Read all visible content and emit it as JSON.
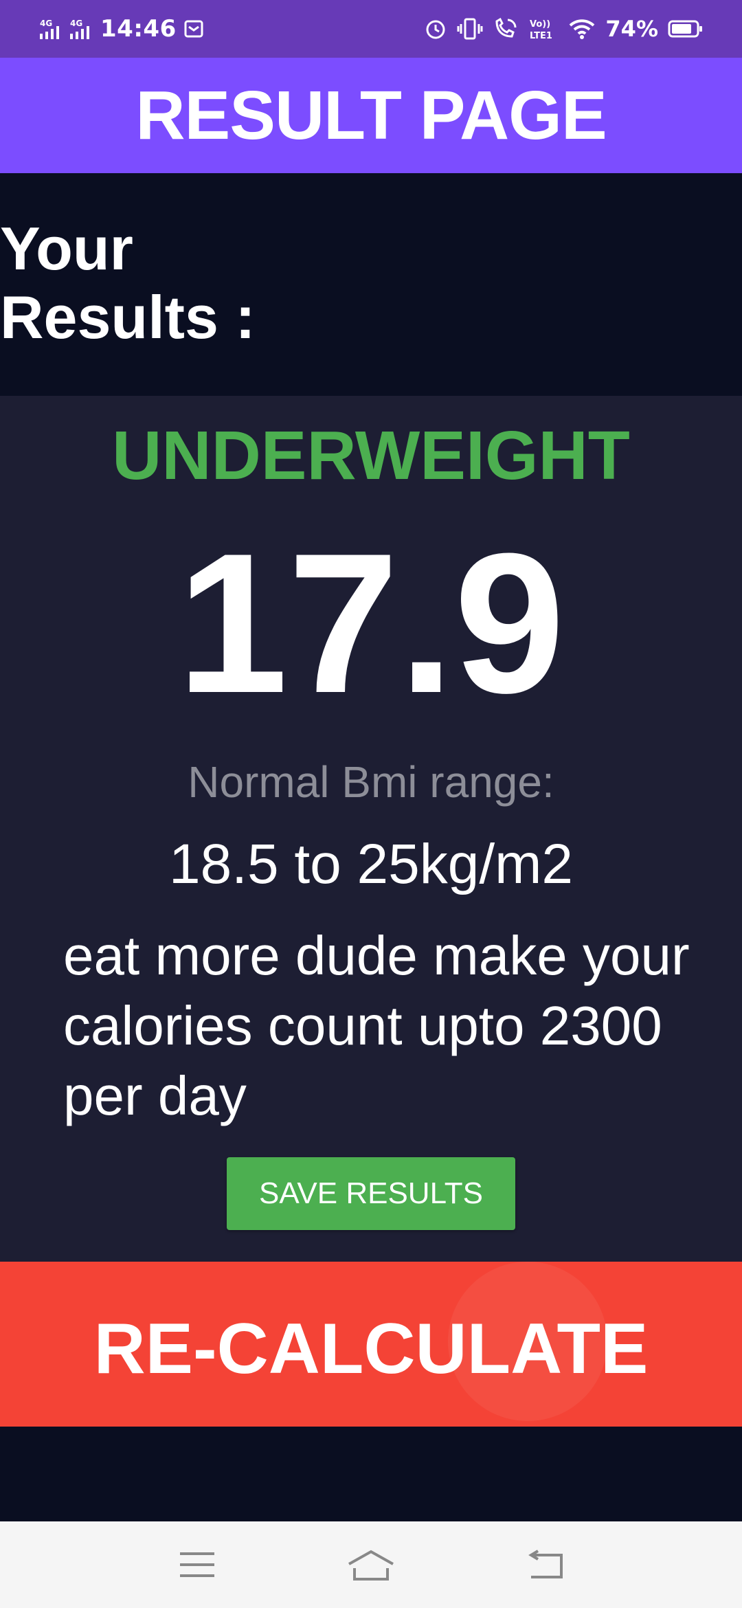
{
  "status_bar": {
    "network_left": "4G",
    "network_right": "4G",
    "time": "14:46",
    "volte_label": "Vo)) LTE1",
    "battery_percent": "74%"
  },
  "app_bar": {
    "title": "RESULT PAGE"
  },
  "heading": {
    "text": "Your Results :"
  },
  "result": {
    "status": "UNDERWEIGHT",
    "bmi": "17.9",
    "range_label": "Normal Bmi range:",
    "range_value": "18.5 to 25kg/m2",
    "advice": "eat more dude make your calories count upto 2300 per day"
  },
  "buttons": {
    "save": "SAVE RESULTS",
    "recalculate": "RE-CALCULATE"
  },
  "colors": {
    "status_bar": "#673ab7",
    "app_bar": "#7c4dff",
    "background": "#0a0e21",
    "card": "#1d1e33",
    "underweight": "#4caf50",
    "save_button": "#4caf50",
    "recalculate_button": "#f44336"
  },
  "icons": {
    "status_left": [
      "signal-icon",
      "signal-icon",
      "mail-icon"
    ],
    "status_right": [
      "alarm-icon",
      "vibrate-icon",
      "wifi-calling-icon",
      "volte-icon",
      "wifi-icon",
      "battery-icon"
    ],
    "nav": [
      "menu-icon",
      "home-icon",
      "back-icon"
    ]
  }
}
